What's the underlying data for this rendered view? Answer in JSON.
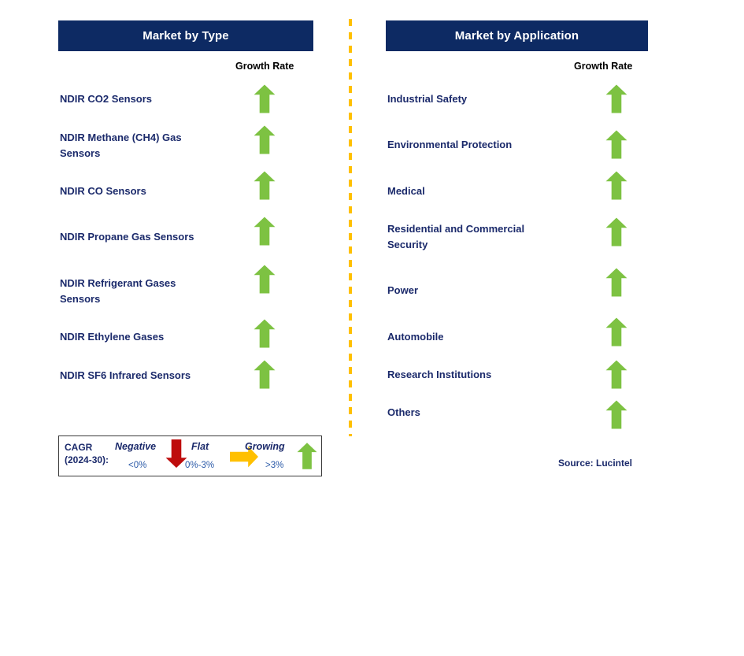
{
  "panels": {
    "left": {
      "title": "Market by Type",
      "growth_rate_label": "Growth Rate",
      "rows": [
        {
          "label": "NDIR CO2 Sensors",
          "growth": "growing",
          "icon": "up-arrow-icon"
        },
        {
          "label": "NDIR Methane (CH4) Gas\nSensors",
          "growth": "growing",
          "icon": "up-arrow-icon"
        },
        {
          "label": "NDIR CO Sensors",
          "growth": "growing",
          "icon": "up-arrow-icon"
        },
        {
          "label": "NDIR Propane Gas Sensors",
          "growth": "growing",
          "icon": "up-arrow-icon"
        },
        {
          "label": "NDIR Refrigerant Gases\nSensors",
          "growth": "growing",
          "icon": "up-arrow-icon"
        },
        {
          "label": "NDIR Ethylene Gases",
          "growth": "growing",
          "icon": "up-arrow-icon"
        },
        {
          "label": "NDIR SF6 Infrared Sensors",
          "growth": "growing",
          "icon": "up-arrow-icon"
        }
      ]
    },
    "right": {
      "title": "Market by Application",
      "growth_rate_label": "Growth Rate",
      "rows": [
        {
          "label": "Industrial Safety",
          "growth": "growing",
          "icon": "up-arrow-icon"
        },
        {
          "label": "Environmental Protection",
          "growth": "growing",
          "icon": "up-arrow-icon"
        },
        {
          "label": "Medical",
          "growth": "growing",
          "icon": "up-arrow-icon"
        },
        {
          "label": "Residential and Commercial\nSecurity",
          "growth": "growing",
          "icon": "up-arrow-icon"
        },
        {
          "label": "Power",
          "growth": "growing",
          "icon": "up-arrow-icon"
        },
        {
          "label": "Automobile",
          "growth": "growing",
          "icon": "up-arrow-icon"
        },
        {
          "label": "Research Institutions",
          "growth": "growing",
          "icon": "up-arrow-icon"
        },
        {
          "label": "Others",
          "growth": "growing",
          "icon": "up-arrow-icon"
        }
      ]
    }
  },
  "legend": {
    "cagr_label": "CAGR\n(2024-30):",
    "items": [
      {
        "term": "Negative",
        "range": "<0%",
        "icon": "down-arrow-icon",
        "color": "#BE0C0C"
      },
      {
        "term": "Flat",
        "range": "0%-3%",
        "icon": "right-arrow-icon",
        "color": "#FFC000"
      },
      {
        "term": "Growing",
        "range": ">3%",
        "icon": "up-arrow-icon",
        "color": "#7DC242"
      }
    ]
  },
  "source": "Source: Lucintel",
  "colors": {
    "header_bar": "#0d2a63",
    "label_text": "#1b2a6b",
    "growing_arrow": "#7DC242",
    "negative_arrow": "#BE0C0C",
    "flat_arrow": "#FFC000",
    "divider": "#FFC000",
    "range_text": "#2b5aa8"
  }
}
